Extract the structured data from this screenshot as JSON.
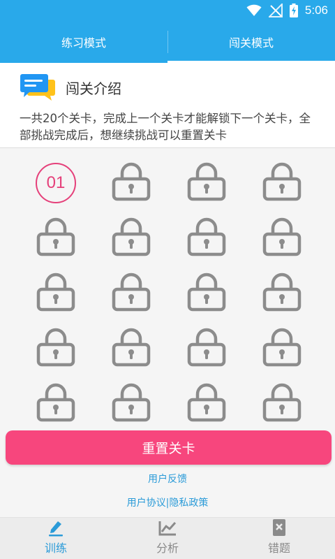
{
  "status_bar": {
    "time": "5:06"
  },
  "top_tabs": [
    {
      "label": "练习模式",
      "active": false
    },
    {
      "label": "闯关模式",
      "active": true
    }
  ],
  "intro": {
    "title": "闯关介绍",
    "description": "一共20个关卡，完成上一个关卡才能解锁下一个关卡，全部挑战完成后，想继续挑战可以重置关卡"
  },
  "levels": {
    "current_label": "01",
    "total": 20,
    "unlocked": 1
  },
  "reset_button": {
    "label": "重置关卡"
  },
  "links": {
    "feedback": "用户反馈",
    "agreement": "用户协议",
    "separator": "|",
    "privacy": "隐私政策"
  },
  "bottom_nav": [
    {
      "label": "训练",
      "icon": "pencil-icon",
      "active": true
    },
    {
      "label": "分析",
      "icon": "line-chart-icon",
      "active": false
    },
    {
      "label": "错题",
      "icon": "wrong-book-icon",
      "active": false
    }
  ],
  "colors": {
    "primary": "#29a9ea",
    "accent_pink": "#f7467d",
    "current_level": "#e5407a",
    "lock_gray": "#8c8c8c",
    "link_blue": "#2b9bd8"
  }
}
